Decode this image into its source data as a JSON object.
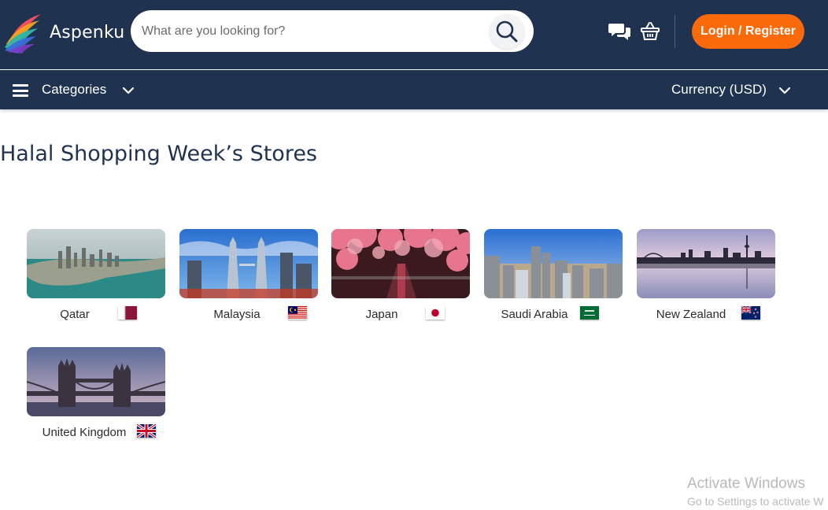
{
  "header": {
    "brand": "Aspenku",
    "search_placeholder": "What are you looking for?",
    "login_label": "Login / Register",
    "colors": {
      "navy": "#1f3350",
      "accent": "#fb6a0a"
    },
    "icons": [
      "logo-icon",
      "search-icon",
      "chat-icon",
      "basket-icon"
    ]
  },
  "navbar": {
    "categories_label": "Categories",
    "currency_label": "Currency (USD)"
  },
  "main": {
    "title": "Halal Shopping Week’s Stores",
    "stores": [
      {
        "name": "Qatar",
        "flag": "qatar-flag"
      },
      {
        "name": "Malaysia",
        "flag": "malaysia-flag"
      },
      {
        "name": "Japan",
        "flag": "japan-flag"
      },
      {
        "name": "Saudi Arabia",
        "flag": "saudi-arabia-flag"
      },
      {
        "name": "New Zealand",
        "flag": "new-zealand-flag"
      },
      {
        "name": "United Kingdom",
        "flag": "united-kingdom-flag"
      }
    ]
  },
  "watermark": {
    "line1": "Activate Windows",
    "line2": "Go to Settings to activate W"
  }
}
